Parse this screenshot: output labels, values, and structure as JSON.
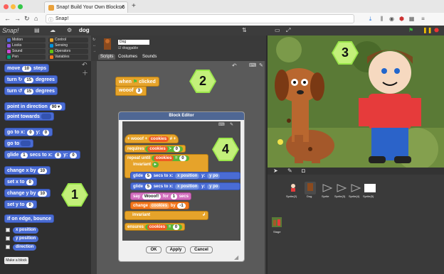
{
  "browser": {
    "tab_title": "Snap! Build Your Own Blocks 5",
    "tab_close": "✕",
    "new_tab": "+",
    "url": "Snap!"
  },
  "snap": {
    "logo": "Snap!",
    "project_name": "dog"
  },
  "categories": [
    "Motion",
    "Looks",
    "Sound",
    "Pen",
    "Control",
    "Sensing",
    "Operators",
    "Variables"
  ],
  "category_colors": [
    "#4a6cd4",
    "#8f56e3",
    "#cf4ad9",
    "#00a178",
    "#e6a32a",
    "#0494dc",
    "#62c213",
    "#f3761d"
  ],
  "palette": {
    "move": {
      "a": "move",
      "n": "10",
      "b": "steps"
    },
    "turn_cw": {
      "a": "turn ↻",
      "n": "15",
      "b": "degrees"
    },
    "turn_ccw": {
      "a": "turn ↺",
      "n": "15",
      "b": "degrees"
    },
    "point_dir": {
      "a": "point in direction",
      "n": "90 ▾"
    },
    "point_towards": {
      "a": "point towards"
    },
    "goto_xy": {
      "a": "go to x:",
      "x": "0",
      "b": "y:",
      "y": "0"
    },
    "goto": {
      "a": "go to"
    },
    "glide": {
      "a": "glide",
      "n": "1",
      "b": "secs to x:",
      "x": "0",
      "c": "y:",
      "y": "0"
    },
    "change_x": {
      "a": "change x by",
      "n": "10"
    },
    "set_x": {
      "a": "set x to",
      "n": "0"
    },
    "change_y": {
      "a": "change y by",
      "n": "10"
    },
    "set_y": {
      "a": "set y to",
      "n": "0"
    },
    "bounce": "if on edge, bounce",
    "reporters": [
      "x position",
      "y position",
      "direction"
    ],
    "make_block": "Make a block"
  },
  "sprite": {
    "name": "Dog",
    "draggable": "draggable",
    "tabs": [
      "Scripts",
      "Costumes",
      "Sounds"
    ]
  },
  "script": {
    "hat": "when",
    "hat_tail": "clicked",
    "woof": "wooof",
    "woof_n": "3"
  },
  "editor": {
    "title": "Block Editor",
    "proto_a": "+ wooof +",
    "proto_var": "cookies",
    "proto_b": "# +",
    "requires": "requires",
    "req_var": "cookies",
    "req_op": ">",
    "req_n": "0",
    "repeat": "repeat until",
    "rep_var": "cookies",
    "rep_op": "=",
    "rep_n": "0",
    "invariant": "invariant",
    "glide_a": "glide",
    "glide_n1": "5",
    "glide_n2": "5",
    "glide_b": "secs to x:",
    "glide_rep": "x position",
    "glide_c": "y:",
    "glide_rep2": "y po",
    "say_a": "say",
    "say_w": "Wooof!",
    "say_b": "for",
    "say_n": "1",
    "say_c": "secs",
    "change_a": "change",
    "change_var": "cookies",
    "change_b": "by",
    "change_n": "-1",
    "invariant2": "invariant",
    "ensures": "ensures",
    "ens_var": "cookies",
    "ens_op": "=",
    "ens_n": "0",
    "ok": "OK",
    "apply": "Apply",
    "cancel": "Cancel"
  },
  "sprites": [
    "Sprite(2)",
    "Dog",
    "Sprite",
    "Sprite(3)",
    "Sprite(4)",
    "Sprite(5)"
  ],
  "stage_label": "Stage",
  "callouts": [
    "1",
    "2",
    "3",
    "4"
  ]
}
